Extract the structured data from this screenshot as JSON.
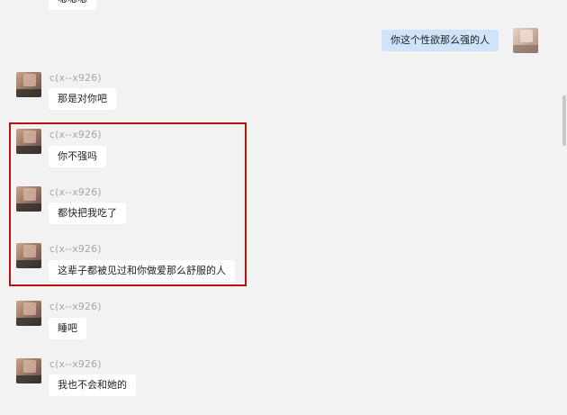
{
  "top_partial": {
    "text": "嗯嗯嗯"
  },
  "self_message": {
    "text": "你这个性欲那么强的人"
  },
  "messages": [
    {
      "sender": "c(x--x926)",
      "text": "那是对你吧"
    },
    {
      "sender": "c(x--x926)",
      "text": "你不强吗"
    },
    {
      "sender": "c(x--x926)",
      "text": "都快把我吃了"
    },
    {
      "sender": "c(x--x926)",
      "text": "这辈子都被见过和你做爱那么舒服的人"
    },
    {
      "sender": "c(x--x926)",
      "text": "睡吧"
    },
    {
      "sender": "c(x--x926)",
      "text": "我也不会和她的"
    }
  ],
  "colors": {
    "background": "#f2f2f2",
    "bubble_other": "#ffffff",
    "bubble_self": "#cfe3fb",
    "highlight_border": "#b31313",
    "sender_text": "#a8a8a8"
  }
}
